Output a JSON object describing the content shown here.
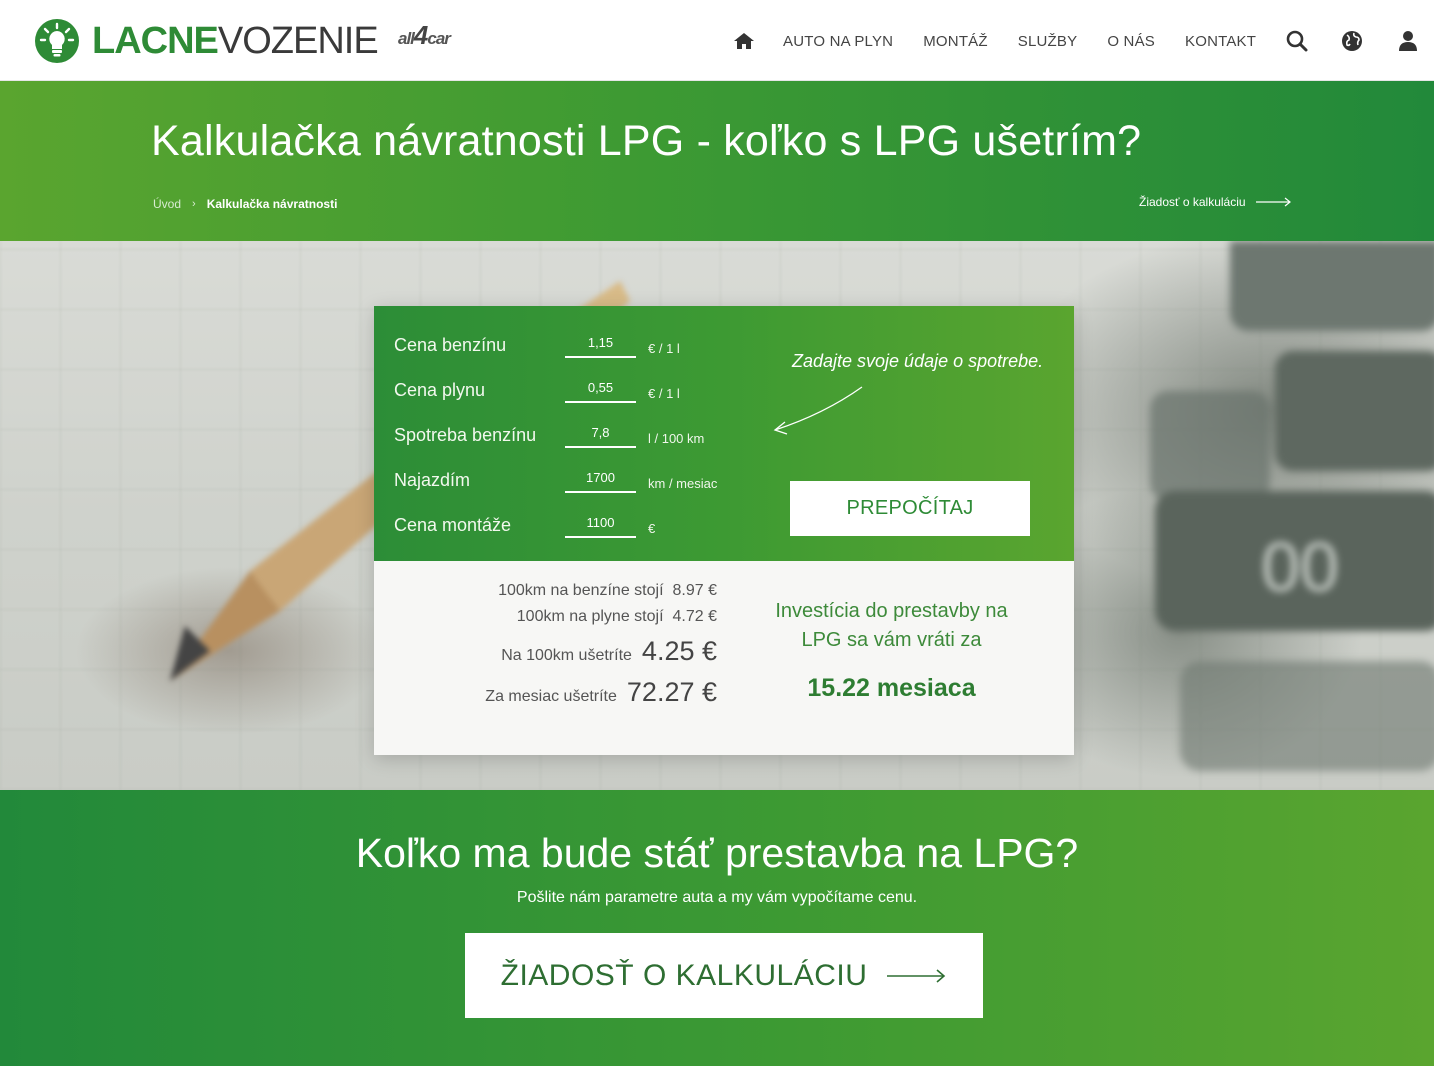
{
  "header": {
    "logo_bold": "LACNE",
    "logo_light": "VOZENIE",
    "partner_a": "all",
    "partner_b": "4",
    "partner_c": "car",
    "nav": [
      "AUTO NA PLYN",
      "MONTÁŽ",
      "SLUŽBY",
      "O NÁS",
      "KONTAKT"
    ],
    "icons": [
      "home-icon",
      "search-icon",
      "globe-icon",
      "user-icon"
    ]
  },
  "title_band": {
    "title": "Kalkulačka návratnosti LPG - koľko s LPG ušetrím?",
    "breadcrumb_home": "Úvod",
    "breadcrumb_sep": "›",
    "breadcrumb_current": "Kalkulačka návratnosti",
    "request_link": "Žiadosť o kalkuláciu"
  },
  "calculator": {
    "rows": [
      {
        "label": "Cena benzínu",
        "value": "1,15",
        "unit": "€ / 1 l"
      },
      {
        "label": "Cena plynu",
        "value": "0,55",
        "unit": "€ / 1 l"
      },
      {
        "label": "Spotreba benzínu",
        "value": "7,8",
        "unit": "l / 100 km"
      },
      {
        "label": "Najazdím",
        "value": "1700",
        "unit": "km / mesiac"
      },
      {
        "label": "Cena montáže",
        "value": "1100",
        "unit": "€"
      }
    ],
    "hint": "Zadajte svoje údaje o spotrebe.",
    "recalc_button": "PREPOČÍTAJ",
    "results": {
      "petrol_label": "100km na benzíne stojí",
      "petrol_value": "8.97 €",
      "gas_label": "100km na plyne stojí",
      "gas_value": "4.72 €",
      "save100_label": "Na 100km ušetríte",
      "save100_value": "4.25 €",
      "savemonth_label": "Za mesiac ušetríte",
      "savemonth_value": "72.27 €"
    },
    "payback_text": "Investícia do prestavby na LPG sa vám vráti za",
    "payback_value": "15.22 mesiaca"
  },
  "cta": {
    "title": "Koľko ma bude stáť prestavba na LPG?",
    "subtitle": "Pošlite nám parametre auta a my vám vypočítame cenu.",
    "button": "ŽIADOSŤ O KALKULÁCIU"
  },
  "colors": {
    "brand_green": "#2e8b36",
    "light_green": "#5aa52f",
    "panel_bottom": "#f7f7f5"
  }
}
